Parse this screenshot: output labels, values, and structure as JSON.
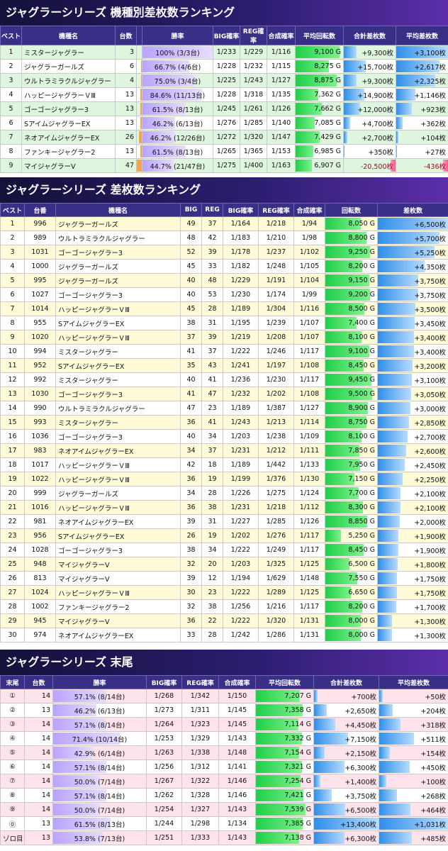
{
  "section1": {
    "title": "ジャグラーシリーズ 機種別差枚数ランキング",
    "headers": [
      "ベスト",
      "機種名",
      "台数",
      "",
      "勝率",
      "BIG確率",
      "REG確率",
      "合成確率",
      "平均回転数",
      "合計差枚数",
      "平均差枚数"
    ],
    "rows": [
      {
        "rank": "1",
        "name": "ミスタージャグラー",
        "units": "3",
        "unitsPct": 0.06,
        "rate": "100% (3/3台)",
        "ratePct": 1.0,
        "big": "1/233",
        "reg": "1/229",
        "comb": "1/116",
        "spins": "9,100 G",
        "spinsPct": 0.92,
        "total": "+9,300枚",
        "totalPct": 0.25,
        "totalNeg": false,
        "avg": "+3,100枚",
        "avgPct": 1.0,
        "avgNeg": false
      },
      {
        "rank": "2",
        "name": "ジャグラーガールズ",
        "units": "6",
        "unitsPct": 0.13,
        "rate": "66.7% (4/6台)",
        "ratePct": 0.667,
        "big": "1/228",
        "reg": "1/232",
        "comb": "1/115",
        "spins": "8,275 G",
        "spinsPct": 0.7,
        "total": "+15,700枚",
        "totalPct": 0.42,
        "totalNeg": false,
        "avg": "+2,617枚",
        "avgPct": 0.84,
        "avgNeg": false
      },
      {
        "rank": "3",
        "name": "ウルトラミラクルジャグラー",
        "units": "4",
        "unitsPct": 0.09,
        "rate": "75.0% (3/4台)",
        "ratePct": 0.75,
        "big": "1/225",
        "reg": "1/243",
        "comb": "1/127",
        "spins": "8,875 G",
        "spinsPct": 0.86,
        "total": "+9,300枚",
        "totalPct": 0.25,
        "totalNeg": false,
        "avg": "+2,325枚",
        "avgPct": 0.75,
        "avgNeg": false
      },
      {
        "rank": "4",
        "name": "ハッピージャグラーＶⅢ",
        "units": "13",
        "unitsPct": 0.28,
        "rate": "84.6% (11/13台)",
        "ratePct": 0.846,
        "big": "1/228",
        "reg": "1/318",
        "comb": "1/135",
        "spins": "7,362 G",
        "spinsPct": 0.48,
        "total": "+14,900枚",
        "totalPct": 0.4,
        "totalNeg": false,
        "avg": "+1,146枚",
        "avgPct": 0.37,
        "avgNeg": false
      },
      {
        "rank": "5",
        "name": "ゴーゴージャグラー3",
        "units": "13",
        "unitsPct": 0.28,
        "rate": "61.5% (8/13台)",
        "ratePct": 0.615,
        "big": "1/245",
        "reg": "1/261",
        "comb": "1/126",
        "spins": "7,662 G",
        "spinsPct": 0.55,
        "total": "+12,000枚",
        "totalPct": 0.32,
        "totalNeg": false,
        "avg": "+923枚",
        "avgPct": 0.3,
        "avgNeg": false
      },
      {
        "rank": "6",
        "name": "SアイムジャグラーEX",
        "units": "13",
        "unitsPct": 0.28,
        "rate": "46.2% (6/13台)",
        "ratePct": 0.462,
        "big": "1/276",
        "reg": "1/285",
        "comb": "1/140",
        "spins": "7,085 G",
        "spinsPct": 0.4,
        "total": "+4,700枚",
        "totalPct": 0.13,
        "totalNeg": false,
        "avg": "+362枚",
        "avgPct": 0.12,
        "avgNeg": false
      },
      {
        "rank": "7",
        "name": "ネオアイムジャグラーEX",
        "units": "26",
        "unitsPct": 0.55,
        "rate": "46.2% (12/26台)",
        "ratePct": 0.462,
        "big": "1/272",
        "reg": "1/320",
        "comb": "1/147",
        "spins": "7,429 G",
        "spinsPct": 0.5,
        "total": "+2,700枚",
        "totalPct": 0.07,
        "totalNeg": false,
        "avg": "+104枚",
        "avgPct": 0.04,
        "avgNeg": false
      },
      {
        "rank": "8",
        "name": "ファンキージャグラー2",
        "units": "13",
        "unitsPct": 0.28,
        "rate": "61.5% (8/13台)",
        "ratePct": 0.615,
        "big": "1/265",
        "reg": "1/365",
        "comb": "1/153",
        "spins": "6,985 G",
        "spinsPct": 0.37,
        "total": "+350枚",
        "totalPct": 0.01,
        "totalNeg": false,
        "avg": "+27枚",
        "avgPct": 0.01,
        "avgNeg": false
      },
      {
        "rank": "9",
        "name": "マイジャグラーV",
        "units": "47",
        "unitsPct": 1.0,
        "rate": "44.7% (21/47台)",
        "ratePct": 0.447,
        "big": "1/275",
        "reg": "1/400",
        "comb": "1/163",
        "spins": "6,907 G",
        "spinsPct": 0.35,
        "total": "-20,500枚",
        "totalPct": 0.1,
        "totalNeg": true,
        "avg": "-436枚",
        "avgPct": 0.1,
        "avgNeg": true
      }
    ]
  },
  "section2": {
    "title": "ジャグラーシリーズ 差枚数ランキング",
    "headers": [
      "ベスト",
      "台番",
      "機種名",
      "BIG",
      "REG",
      "BIG確率",
      "REG確率",
      "合成確率",
      "回転数",
      "差枚数"
    ],
    "rows": [
      {
        "rank": "1",
        "no": "996",
        "name": "ジャグラーガールズ",
        "big": "49",
        "reg": "37",
        "bp": "1/164",
        "rp": "1/218",
        "cp": "1/94",
        "spins": "8,050 G",
        "spinsPct": 0.69,
        "diff": "+6,500枚",
        "diffPct": 1.0
      },
      {
        "rank": "2",
        "no": "989",
        "name": "ウルトラミラクルジャグラー",
        "big": "48",
        "reg": "42",
        "bp": "1/183",
        "rp": "1/210",
        "cp": "1/98",
        "spins": "8,800 G",
        "spinsPct": 0.8,
        "diff": "+5,700枚",
        "diffPct": 0.88
      },
      {
        "rank": "3",
        "no": "1031",
        "name": "ゴーゴージャグラー3",
        "big": "52",
        "reg": "39",
        "bp": "1/178",
        "rp": "1/237",
        "cp": "1/102",
        "spins": "9,250 G",
        "spinsPct": 0.86,
        "diff": "+5,250枚",
        "diffPct": 0.81
      },
      {
        "rank": "4",
        "no": "1000",
        "name": "ジャグラーガールズ",
        "big": "45",
        "reg": "33",
        "bp": "1/182",
        "rp": "1/248",
        "cp": "1/105",
        "spins": "8,200 G",
        "spinsPct": 0.71,
        "diff": "+4,350枚",
        "diffPct": 0.67
      },
      {
        "rank": "5",
        "no": "995",
        "name": "ジャグラーガールズ",
        "big": "40",
        "reg": "48",
        "bp": "1/229",
        "rp": "1/191",
        "cp": "1/104",
        "spins": "9,150 G",
        "spinsPct": 0.85,
        "diff": "+3,750枚",
        "diffPct": 0.58
      },
      {
        "rank": "6",
        "no": "1027",
        "name": "ゴーゴージャグラー3",
        "big": "40",
        "reg": "53",
        "bp": "1/230",
        "rp": "1/174",
        "cp": "1/99",
        "spins": "9,200 G",
        "spinsPct": 0.86,
        "diff": "+3,750枚",
        "diffPct": 0.58
      },
      {
        "rank": "7",
        "no": "1014",
        "name": "ハッピージャグラーＶⅢ",
        "big": "45",
        "reg": "28",
        "bp": "1/189",
        "rp": "1/304",
        "cp": "1/116",
        "spins": "8,500 G",
        "spinsPct": 0.75,
        "diff": "+3,500枚",
        "diffPct": 0.54
      },
      {
        "rank": "8",
        "no": "955",
        "name": "SアイムジャグラーEX",
        "big": "38",
        "reg": "31",
        "bp": "1/195",
        "rp": "1/239",
        "cp": "1/107",
        "spins": "7,400 G",
        "spinsPct": 0.6,
        "diff": "+3,450枚",
        "diffPct": 0.53
      },
      {
        "rank": "9",
        "no": "1020",
        "name": "ハッピージャグラーＶⅢ",
        "big": "37",
        "reg": "39",
        "bp": "1/219",
        "rp": "1/208",
        "cp": "1/107",
        "spins": "8,100 G",
        "spinsPct": 0.7,
        "diff": "+3,400枚",
        "diffPct": 0.52
      },
      {
        "rank": "10",
        "no": "994",
        "name": "ミスタージャグラー",
        "big": "41",
        "reg": "37",
        "bp": "1/222",
        "rp": "1/246",
        "cp": "1/117",
        "spins": "9,100 G",
        "spinsPct": 0.85,
        "diff": "+3,400枚",
        "diffPct": 0.52
      },
      {
        "rank": "11",
        "no": "952",
        "name": "SアイムジャグラーEX",
        "big": "35",
        "reg": "43",
        "bp": "1/241",
        "rp": "1/197",
        "cp": "1/108",
        "spins": "8,450 G",
        "spinsPct": 0.74,
        "diff": "+3,200枚",
        "diffPct": 0.49
      },
      {
        "rank": "12",
        "no": "992",
        "name": "ミスタージャグラー",
        "big": "40",
        "reg": "41",
        "bp": "1/236",
        "rp": "1/230",
        "cp": "1/117",
        "spins": "9,450 G",
        "spinsPct": 0.89,
        "diff": "+3,100枚",
        "diffPct": 0.48
      },
      {
        "rank": "13",
        "no": "1030",
        "name": "ゴーゴージャグラー3",
        "big": "41",
        "reg": "47",
        "bp": "1/232",
        "rp": "1/202",
        "cp": "1/108",
        "spins": "9,500 G",
        "spinsPct": 0.9,
        "diff": "+3,050枚",
        "diffPct": 0.47
      },
      {
        "rank": "14",
        "no": "990",
        "name": "ウルトラミラクルジャグラー",
        "big": "47",
        "reg": "23",
        "bp": "1/189",
        "rp": "1/387",
        "cp": "1/127",
        "spins": "8,900 G",
        "spinsPct": 0.82,
        "diff": "+3,000枚",
        "diffPct": 0.46
      },
      {
        "rank": "15",
        "no": "993",
        "name": "ミスタージャグラー",
        "big": "36",
        "reg": "41",
        "bp": "1/243",
        "rp": "1/213",
        "cp": "1/114",
        "spins": "8,750 G",
        "spinsPct": 0.79,
        "diff": "+2,850枚",
        "diffPct": 0.44
      },
      {
        "rank": "16",
        "no": "1036",
        "name": "ゴーゴージャグラー3",
        "big": "40",
        "reg": "34",
        "bp": "1/203",
        "rp": "1/238",
        "cp": "1/109",
        "spins": "8,100 G",
        "spinsPct": 0.7,
        "diff": "+2,700枚",
        "diffPct": 0.42
      },
      {
        "rank": "17",
        "no": "983",
        "name": "ネオアイムジャグラーEX",
        "big": "34",
        "reg": "37",
        "bp": "1/231",
        "rp": "1/212",
        "cp": "1/111",
        "spins": "7,850 G",
        "spinsPct": 0.66,
        "diff": "+2,600枚",
        "diffPct": 0.4
      },
      {
        "rank": "18",
        "no": "1017",
        "name": "ハッピージャグラーＶⅢ",
        "big": "42",
        "reg": "18",
        "bp": "1/189",
        "rp": "1/442",
        "cp": "1/133",
        "spins": "7,950 G",
        "spinsPct": 0.67,
        "diff": "+2,450枚",
        "diffPct": 0.38
      },
      {
        "rank": "19",
        "no": "1022",
        "name": "ハッピージャグラーＶⅢ",
        "big": "36",
        "reg": "19",
        "bp": "1/199",
        "rp": "1/376",
        "cp": "1/130",
        "spins": "7,150 G",
        "spinsPct": 0.56,
        "diff": "+2,250枚",
        "diffPct": 0.35
      },
      {
        "rank": "20",
        "no": "999",
        "name": "ジャグラーガールズ",
        "big": "34",
        "reg": "28",
        "bp": "1/226",
        "rp": "1/275",
        "cp": "1/124",
        "spins": "7,700 G",
        "spinsPct": 0.64,
        "diff": "+2,100枚",
        "diffPct": 0.32
      },
      {
        "rank": "21",
        "no": "1016",
        "name": "ハッピージャグラーＶⅢ",
        "big": "36",
        "reg": "38",
        "bp": "1/231",
        "rp": "1/218",
        "cp": "1/112",
        "spins": "8,300 G",
        "spinsPct": 0.72,
        "diff": "+2,100枚",
        "diffPct": 0.32
      },
      {
        "rank": "22",
        "no": "981",
        "name": "ネオアイムジャグラーEX",
        "big": "39",
        "reg": "31",
        "bp": "1/227",
        "rp": "1/285",
        "cp": "1/126",
        "spins": "8,850 G",
        "spinsPct": 0.81,
        "diff": "+2,000枚",
        "diffPct": 0.31
      },
      {
        "rank": "23",
        "no": "956",
        "name": "SアイムジャグラーEX",
        "big": "26",
        "reg": "19",
        "bp": "1/202",
        "rp": "1/276",
        "cp": "1/117",
        "spins": "5,250 G",
        "spinsPct": 0.3,
        "diff": "+1,900枚",
        "diffPct": 0.29
      },
      {
        "rank": "24",
        "no": "1028",
        "name": "ゴーゴージャグラー3",
        "big": "38",
        "reg": "34",
        "bp": "1/222",
        "rp": "1/249",
        "cp": "1/117",
        "spins": "8,450 G",
        "spinsPct": 0.74,
        "diff": "+1,900枚",
        "diffPct": 0.29
      },
      {
        "rank": "25",
        "no": "948",
        "name": "マイジャグラーV",
        "big": "32",
        "reg": "20",
        "bp": "1/203",
        "rp": "1/325",
        "cp": "1/125",
        "spins": "6,500 G",
        "spinsPct": 0.47,
        "diff": "+1,800枚",
        "diffPct": 0.28
      },
      {
        "rank": "26",
        "no": "813",
        "name": "マイジャグラーV",
        "big": "39",
        "reg": "12",
        "bp": "1/194",
        "rp": "1/629",
        "cp": "1/148",
        "spins": "7,550 G",
        "spinsPct": 0.62,
        "diff": "+1,750枚",
        "diffPct": 0.27
      },
      {
        "rank": "27",
        "no": "1024",
        "name": "ハッピージャグラーＶⅢ",
        "big": "30",
        "reg": "23",
        "bp": "1/222",
        "rp": "1/289",
        "cp": "1/125",
        "spins": "6,650 G",
        "spinsPct": 0.49,
        "diff": "+1,750枚",
        "diffPct": 0.27
      },
      {
        "rank": "28",
        "no": "1002",
        "name": "ファンキージャグラー2",
        "big": "32",
        "reg": "38",
        "bp": "1/256",
        "rp": "1/216",
        "cp": "1/117",
        "spins": "8,200 G",
        "spinsPct": 0.71,
        "diff": "+1,700枚",
        "diffPct": 0.26
      },
      {
        "rank": "29",
        "no": "945",
        "name": "マイジャグラーV",
        "big": "36",
        "reg": "22",
        "bp": "1/222",
        "rp": "1/320",
        "cp": "1/131",
        "spins": "8,000 G",
        "spinsPct": 0.69,
        "diff": "+1,300枚",
        "diffPct": 0.2
      },
      {
        "rank": "30",
        "no": "974",
        "name": "ネオアイムジャグラーEX",
        "big": "33",
        "reg": "28",
        "bp": "1/242",
        "rp": "1/286",
        "cp": "1/131",
        "spins": "8,000 G",
        "spinsPct": 0.69,
        "diff": "+1,300枚",
        "diffPct": 0.2
      }
    ]
  },
  "section3": {
    "title": "ジャグラーシリーズ 末尾",
    "headers": [
      "末尾",
      "台数",
      "勝率",
      "BIG確率",
      "REG確率",
      "合成確率",
      "平均回転数",
      "合計差枚数",
      "平均差枚数"
    ],
    "rows": [
      {
        "tail": "①",
        "units": "14",
        "rate": "57.1% (8/14台)",
        "ratePct": 0.571,
        "big": "1/268",
        "reg": "1/342",
        "comb": "1/150",
        "spins": "7,207 G",
        "spinsPct": 0.77,
        "total": "+700枚",
        "totalPct": 0.05,
        "avg": "+50枚",
        "avgPct": 0.05
      },
      {
        "tail": "②",
        "units": "13",
        "rate": "46.2% (6/13台)",
        "ratePct": 0.462,
        "big": "1/273",
        "reg": "1/311",
        "comb": "1/145",
        "spins": "7,358 G",
        "spinsPct": 0.81,
        "total": "+2,650枚",
        "totalPct": 0.2,
        "avg": "+204枚",
        "avgPct": 0.2
      },
      {
        "tail": "③",
        "units": "14",
        "rate": "57.1% (8/14台)",
        "ratePct": 0.571,
        "big": "1/264",
        "reg": "1/323",
        "comb": "1/145",
        "spins": "7,114 G",
        "spinsPct": 0.74,
        "total": "+4,450枚",
        "totalPct": 0.33,
        "avg": "+318枚",
        "avgPct": 0.31
      },
      {
        "tail": "④",
        "units": "14",
        "rate": "71.4% (10/14台)",
        "ratePct": 0.714,
        "big": "1/253",
        "reg": "1/329",
        "comb": "1/143",
        "spins": "7,332 G",
        "spinsPct": 0.8,
        "total": "+7,150枚",
        "totalPct": 0.53,
        "avg": "+511枚",
        "avgPct": 0.5
      },
      {
        "tail": "⑤",
        "units": "14",
        "rate": "42.9% (6/14台)",
        "ratePct": 0.429,
        "big": "1/263",
        "reg": "1/338",
        "comb": "1/148",
        "spins": "7,154 G",
        "spinsPct": 0.75,
        "total": "+2,150枚",
        "totalPct": 0.16,
        "avg": "+154枚",
        "avgPct": 0.15
      },
      {
        "tail": "⑥",
        "units": "14",
        "rate": "57.1% (8/14台)",
        "ratePct": 0.571,
        "big": "1/256",
        "reg": "1/312",
        "comb": "1/141",
        "spins": "7,321 G",
        "spinsPct": 0.8,
        "total": "+6,300枚",
        "totalPct": 0.47,
        "avg": "+450枚",
        "avgPct": 0.44
      },
      {
        "tail": "⑦",
        "units": "14",
        "rate": "50.0% (7/14台)",
        "ratePct": 0.5,
        "big": "1/267",
        "reg": "1/322",
        "comb": "1/146",
        "spins": "7,254 G",
        "spinsPct": 0.78,
        "total": "+1,400枚",
        "totalPct": 0.1,
        "avg": "+100枚",
        "avgPct": 0.1
      },
      {
        "tail": "⑧",
        "units": "14",
        "rate": "57.1% (8/14台)",
        "ratePct": 0.571,
        "big": "1/262",
        "reg": "1/328",
        "comb": "1/146",
        "spins": "7,421 G",
        "spinsPct": 0.83,
        "total": "+3,750枚",
        "totalPct": 0.28,
        "avg": "+268枚",
        "avgPct": 0.26
      },
      {
        "tail": "⑨",
        "units": "14",
        "rate": "50.0% (7/14台)",
        "ratePct": 0.5,
        "big": "1/254",
        "reg": "1/327",
        "comb": "1/143",
        "spins": "7,539 G",
        "spinsPct": 0.86,
        "total": "+6,500枚",
        "totalPct": 0.48,
        "avg": "+464枚",
        "avgPct": 0.45
      },
      {
        "tail": "⓪",
        "units": "13",
        "rate": "61.5% (8/13台)",
        "ratePct": 0.615,
        "big": "1/244",
        "reg": "1/298",
        "comb": "1/134",
        "spins": "7,385 G",
        "spinsPct": 0.82,
        "total": "+13,400枚",
        "totalPct": 1.0,
        "avg": "+1,031枚",
        "avgPct": 1.0
      },
      {
        "tail": "ゾロ目",
        "units": "13",
        "rate": "53.8% (7/13台)",
        "ratePct": 0.538,
        "big": "1/251",
        "reg": "1/333",
        "comb": "1/143",
        "spins": "7,138 G",
        "spinsPct": 0.75,
        "total": "+6,300枚",
        "totalPct": 0.47,
        "avg": "+485枚",
        "avgPct": 0.47
      }
    ]
  }
}
